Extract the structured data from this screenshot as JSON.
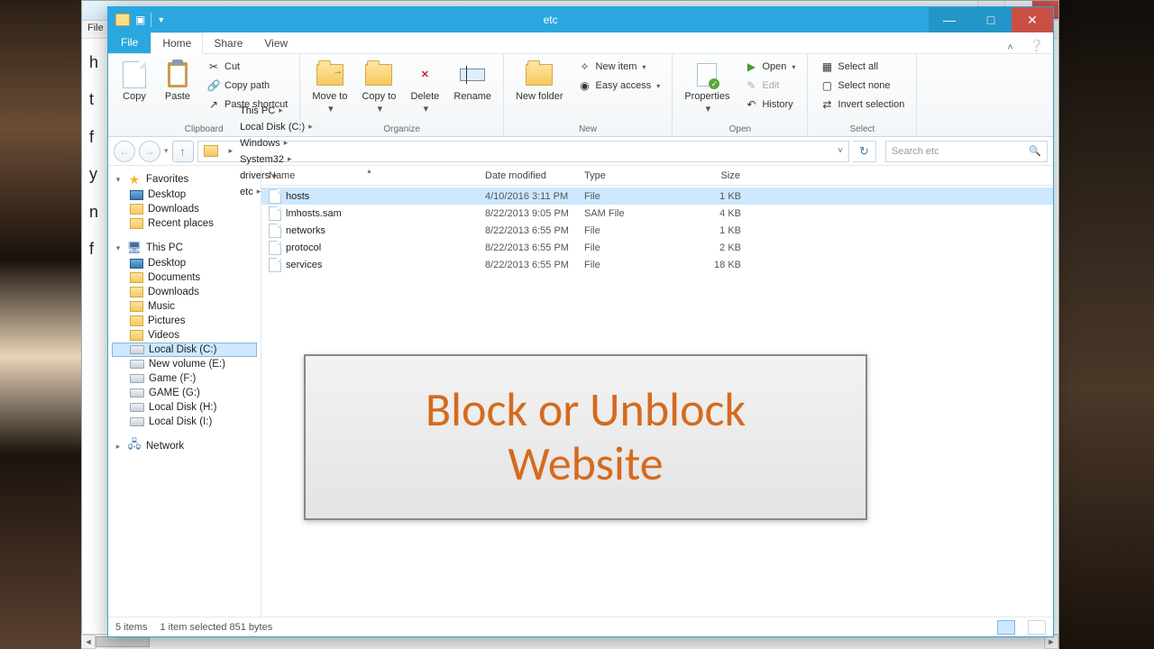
{
  "background_window": {
    "menu_file": "File",
    "body_lines": [
      "h",
      "t",
      "f",
      "y",
      "n",
      "f"
    ]
  },
  "window": {
    "title": "etc"
  },
  "ribbon_tabs": {
    "file": "File",
    "home": "Home",
    "share": "Share",
    "view": "View"
  },
  "ribbon": {
    "clipboard": {
      "copy": "Copy",
      "paste": "Paste",
      "cut": "Cut",
      "copy_path": "Copy path",
      "paste_shortcut": "Paste shortcut",
      "group": "Clipboard"
    },
    "organize": {
      "move_to": "Move\nto",
      "copy_to": "Copy\nto",
      "delete": "Delete",
      "rename": "Rename",
      "group": "Organize"
    },
    "new": {
      "new_folder": "New\nfolder",
      "new_item": "New item",
      "easy_access": "Easy access",
      "group": "New"
    },
    "open": {
      "properties": "Properties",
      "open": "Open",
      "edit": "Edit",
      "history": "History",
      "group": "Open"
    },
    "select": {
      "select_all": "Select all",
      "select_none": "Select none",
      "invert": "Invert selection",
      "group": "Select"
    }
  },
  "breadcrumbs": [
    "This PC",
    "Local Disk (C:)",
    "Windows",
    "System32",
    "drivers",
    "etc"
  ],
  "search_placeholder": "Search etc",
  "nav": {
    "favorites": "Favorites",
    "favorites_items": [
      "Desktop",
      "Downloads",
      "Recent places"
    ],
    "this_pc": "This PC",
    "pc_items": [
      "Desktop",
      "Documents",
      "Downloads",
      "Music",
      "Pictures",
      "Videos",
      "Local Disk (C:)",
      "New volume (E:)",
      "Game (F:)",
      "GAME (G:)",
      "Local Disk (H:)",
      "Local Disk (I:)"
    ],
    "network": "Network"
  },
  "columns": {
    "name": "Name",
    "date": "Date modified",
    "type": "Type",
    "size": "Size"
  },
  "files": [
    {
      "name": "hosts",
      "date": "4/10/2016 3:11 PM",
      "type": "File",
      "size": "1 KB",
      "selected": true
    },
    {
      "name": "lmhosts.sam",
      "date": "8/22/2013 9:05 PM",
      "type": "SAM File",
      "size": "4 KB",
      "selected": false
    },
    {
      "name": "networks",
      "date": "8/22/2013 6:55 PM",
      "type": "File",
      "size": "1 KB",
      "selected": false
    },
    {
      "name": "protocol",
      "date": "8/22/2013 6:55 PM",
      "type": "File",
      "size": "2 KB",
      "selected": false
    },
    {
      "name": "services",
      "date": "8/22/2013 6:55 PM",
      "type": "File",
      "size": "18 KB",
      "selected": false
    }
  ],
  "status": {
    "count": "5 items",
    "selection": "1 item selected  851 bytes"
  },
  "banner": {
    "line1": "Block or Unblock",
    "line2": "Website"
  }
}
